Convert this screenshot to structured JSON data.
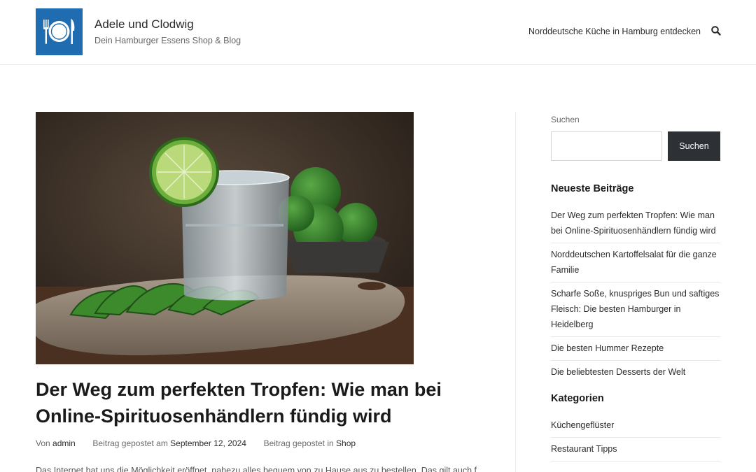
{
  "header": {
    "site_title": "Adele und Clodwig",
    "site_description": "Dein Hamburger Essens Shop & Blog",
    "logo_icon": "plate-cutlery-icon",
    "nav_link": "Norddeutsche Küche in Hamburg entdecken",
    "search_icon": "search-icon"
  },
  "post": {
    "title": "Der Weg zum perfekten Tropfen: Wie man bei Online-Spirituosenhändlern fündig wird",
    "meta": {
      "author_prefix": "Von",
      "author": "admin",
      "date_prefix": "Beitrag gepostet am",
      "date": "September 12, 2024",
      "category_prefix": "Beitrag gepostet in",
      "category": "Shop"
    },
    "excerpt": "Das Internet hat uns die Möglichkeit eröffnet, nahezu alles bequem von zu Hause aus zu bestellen. Das gilt auch für"
  },
  "sidebar": {
    "search": {
      "label": "Suchen",
      "placeholder": "",
      "button": "Suchen"
    },
    "recent_posts": {
      "title": "Neueste Beiträge",
      "items": [
        "Der Weg zum perfekten Tropfen: Wie man bei Online-Spirituosenhändlern fündig wird",
        "Norddeutschen Kartoffelsalat für die ganze Familie",
        "Scharfe Soße, knuspriges Bun und saftiges Fleisch: Die besten Hamburger in Heidelberg",
        "Die besten Hummer Rezepte",
        "Die beliebtesten Desserts der Welt"
      ]
    },
    "categories": {
      "title": "Kategorien",
      "items": [
        "Küchengeflüster",
        "Restaurant Tipps"
      ]
    }
  },
  "colors": {
    "logo_bg": "#1f6db0",
    "button_bg": "#2d3035",
    "text": "#2b2b2b"
  }
}
